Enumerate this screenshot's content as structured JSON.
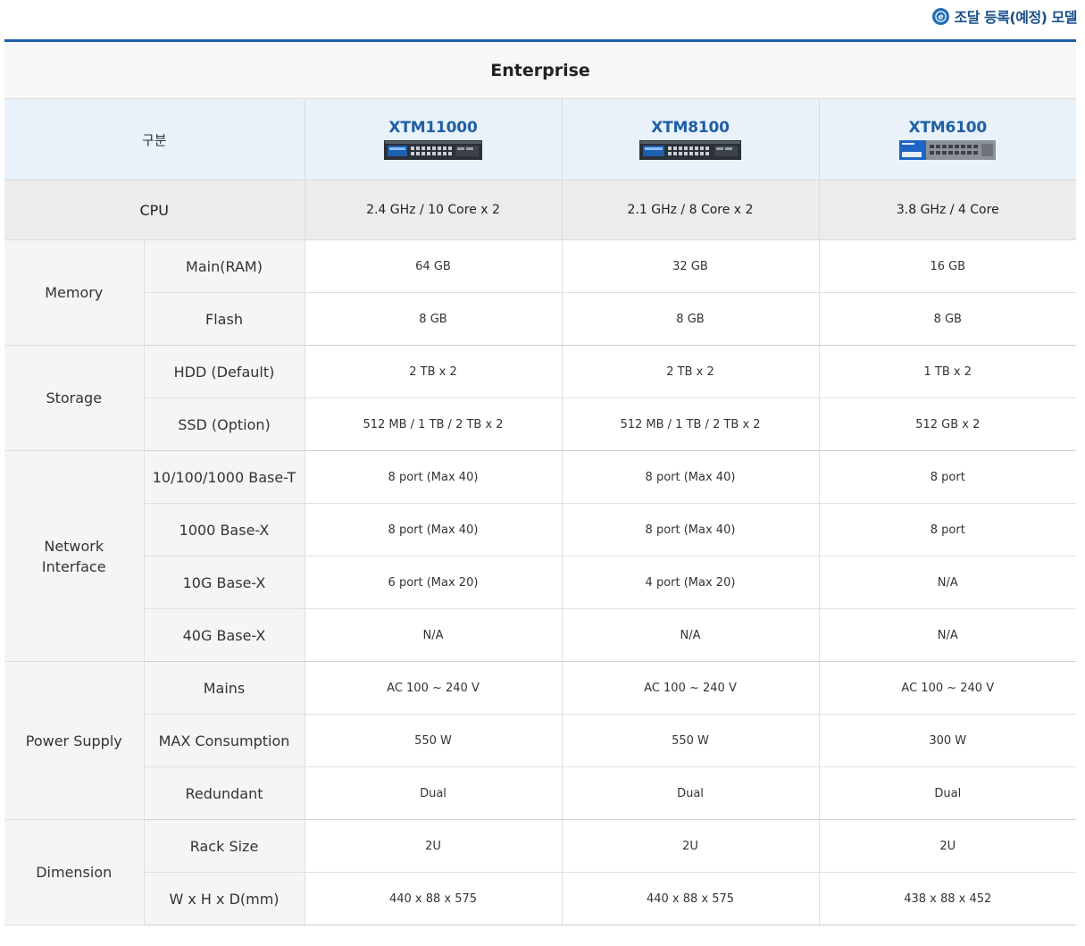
{
  "legend": {
    "icon": "procurement-e-icon",
    "text": "조달 등록(예정) 모델"
  },
  "colors": {
    "accent": "#1e5fa5",
    "header_bg": "#e9f2fb",
    "label_bg": "#f5f5f5",
    "cpu_bg": "#ececec"
  },
  "table": {
    "title": "Enterprise",
    "header_label": "구분",
    "models": [
      {
        "name": "XTM11000",
        "image": "appliance-rack-2u-dark"
      },
      {
        "name": "XTM8100",
        "image": "appliance-rack-2u-dark"
      },
      {
        "name": "XTM6100",
        "image": "appliance-rack-blue"
      }
    ],
    "cpu": {
      "label": "CPU",
      "values": [
        "2.4 GHz / 10 Core x 2",
        "2.1 GHz / 8 Core x 2",
        "3.8 GHz / 4 Core"
      ]
    },
    "groups": [
      {
        "label": "Memory",
        "rows": [
          {
            "label": "Main(RAM)",
            "values": [
              "64 GB",
              "32 GB",
              "16 GB"
            ]
          },
          {
            "label": "Flash",
            "values": [
              "8 GB",
              "8 GB",
              "8 GB"
            ]
          }
        ]
      },
      {
        "label": "Storage",
        "rows": [
          {
            "label": "HDD (Default)",
            "values": [
              "2 TB x 2",
              "2 TB x 2",
              "1 TB x 2"
            ]
          },
          {
            "label": "SSD (Option)",
            "values": [
              "512 MB / 1 TB / 2 TB x 2",
              "512 MB / 1 TB / 2 TB x 2",
              "512 GB x 2"
            ]
          }
        ]
      },
      {
        "label": "Network\nInterface",
        "rows": [
          {
            "label": "10/100/1000 Base-T",
            "values": [
              "8 port (Max 40)",
              "8 port (Max 40)",
              "8 port"
            ]
          },
          {
            "label": "1000 Base-X",
            "values": [
              "8 port (Max 40)",
              "8 port (Max 40)",
              "8 port"
            ]
          },
          {
            "label": "10G Base-X",
            "values": [
              "6 port (Max 20)",
              "4 port (Max 20)",
              "N/A"
            ]
          },
          {
            "label": "40G Base-X",
            "values": [
              "N/A",
              "N/A",
              "N/A"
            ]
          }
        ]
      },
      {
        "label": "Power Supply",
        "rows": [
          {
            "label": "Mains",
            "values": [
              "AC 100 ~ 240 V",
              "AC 100 ~ 240 V",
              "AC 100 ~ 240 V"
            ]
          },
          {
            "label": "MAX Consumption",
            "values": [
              "550 W",
              "550 W",
              "300 W"
            ]
          },
          {
            "label": "Redundant",
            "values": [
              "Dual",
              "Dual",
              "Dual"
            ]
          }
        ]
      },
      {
        "label": "Dimension",
        "rows": [
          {
            "label": "Rack Size",
            "values": [
              "2U",
              "2U",
              "2U"
            ]
          },
          {
            "label": "W x H x D(mm)",
            "values": [
              "440 x 88 x 575",
              "440 x 88 x 575",
              "438 x 88 x 452"
            ]
          }
        ]
      }
    ]
  }
}
